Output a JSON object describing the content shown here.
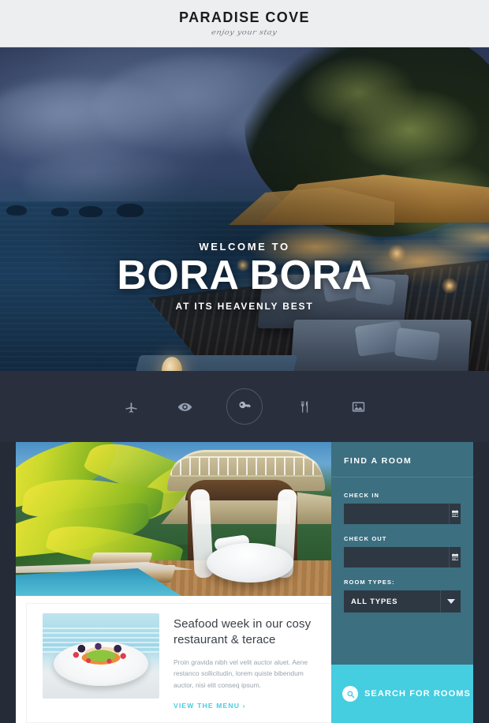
{
  "header": {
    "brand": "PARADISE COVE",
    "tagline": "enjoy your stay"
  },
  "hero": {
    "kicker": "WELCOME TO",
    "title": "BORA BORA",
    "subtitle": "AT ITS HEAVENLY BEST"
  },
  "nav": {
    "items": [
      {
        "icon": "airplane-icon",
        "name": "nav-travel",
        "active": false
      },
      {
        "icon": "eye-icon",
        "name": "nav-sights",
        "active": false
      },
      {
        "icon": "key-icon",
        "name": "nav-rooms",
        "active": true
      },
      {
        "icon": "cutlery-icon",
        "name": "nav-dining",
        "active": false
      },
      {
        "icon": "photo-icon",
        "name": "nav-gallery",
        "active": false
      }
    ]
  },
  "promo": {
    "title": "Seafood week in our cosy restaurant & terace",
    "text": "Proin gravida nibh vel velit auctor aluet. Aene restanco sollicitudin, lorem quiste bibendum auctor, nisi elit conseq ipsum.",
    "link": "VIEW THE MENU ›"
  },
  "booking": {
    "title": "FIND A ROOM",
    "check_in_label": "CHECK IN",
    "check_in_value": "",
    "check_in_placeholder": "",
    "check_out_label": "CHECK OUT",
    "check_out_value": "",
    "check_out_placeholder": "",
    "room_types_label": "ROOM TYPES:",
    "room_types_value": "ALL TYPES",
    "search_label": "SEARCH FOR ROOMS"
  },
  "colors": {
    "accent_cyan": "#45cde0",
    "panel_teal": "#3c6f80",
    "dark_navy": "#262b38",
    "nav_bar": "#2a2f3d",
    "input_dark": "#2e3842",
    "header_gray": "#eceef0"
  }
}
